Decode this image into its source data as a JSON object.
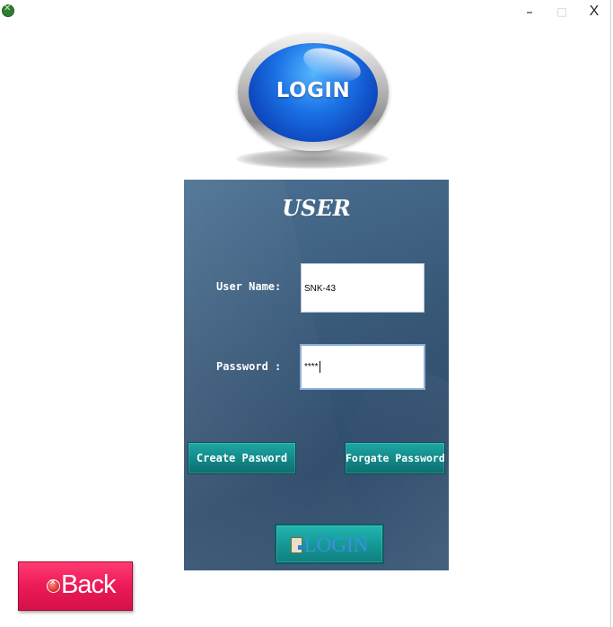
{
  "window": {
    "app_icon": "app-logo-icon",
    "minimize_label": "–",
    "maximize_label": "□",
    "close_label": "X"
  },
  "logo": {
    "text": "LOGIN"
  },
  "panel": {
    "title": "USER",
    "username_label": "User Name:",
    "username_value": "SNK-43",
    "password_label": "Password :",
    "password_value": "****",
    "create_button": "Create Pasword",
    "forgot_button": "Forgate Password",
    "login_button": "LOGIN",
    "login_icon": "document-icon"
  },
  "back_button": {
    "label": "Back",
    "icon": "close-circle-icon"
  },
  "colors": {
    "panel_bg": "#3a5a7a",
    "teal_button": "#128786",
    "back_button": "#ec1a57",
    "logo_blue": "#1b72e6"
  }
}
